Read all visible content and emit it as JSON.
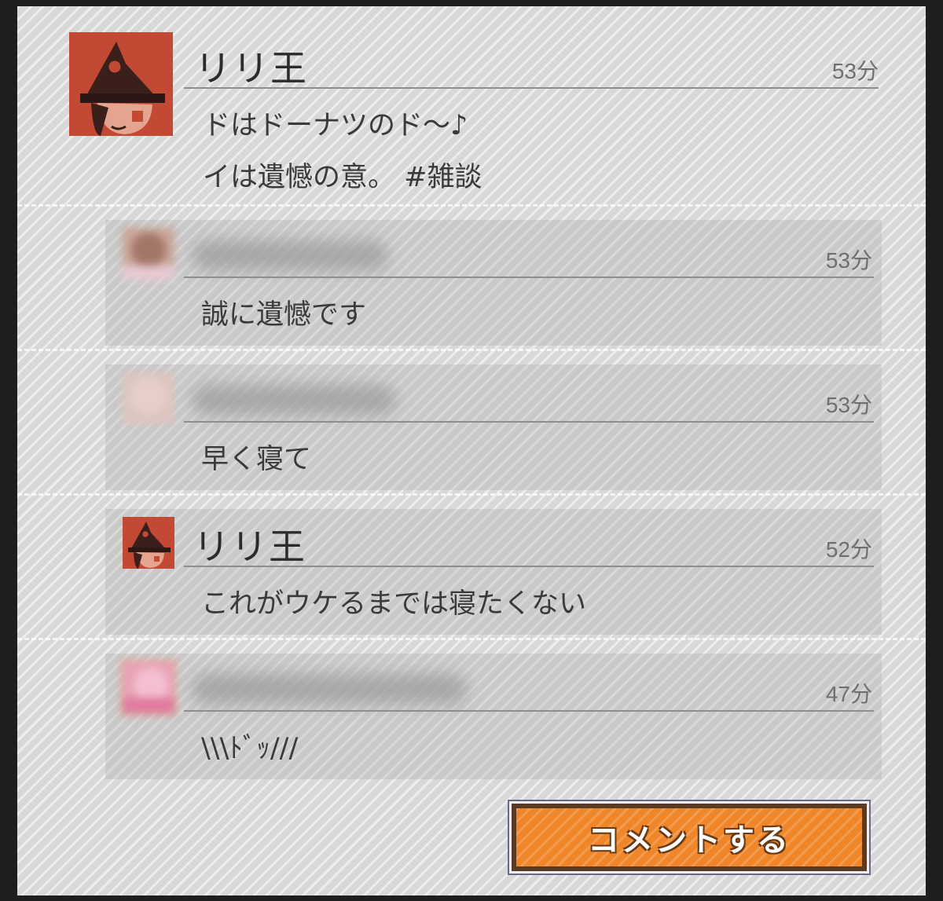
{
  "post": {
    "author": "リリ王",
    "time": "53分",
    "lines": [
      "ドはドーナツのド～♪",
      "イは遺憾の意。 #雑談"
    ]
  },
  "comments": [
    {
      "author": "",
      "time": "53分",
      "text": "誠に遺憾です"
    },
    {
      "author": "",
      "time": "53分",
      "text": "早く寝て"
    },
    {
      "author": "リリ王",
      "time": "52分",
      "text": "これがウケるまでは寝たくない"
    },
    {
      "author": "",
      "time": "47分",
      "text": "\\\\\\ﾄﾞｯ///"
    }
  ],
  "comment_button": {
    "label": "コメントする"
  },
  "icons": {
    "author_avatar": "witch-hat-avatar-icon",
    "user_avatar": "blurred-avatar-icon"
  },
  "colors": {
    "button": "#f0862a",
    "avatar_bg": "#c24a34"
  }
}
